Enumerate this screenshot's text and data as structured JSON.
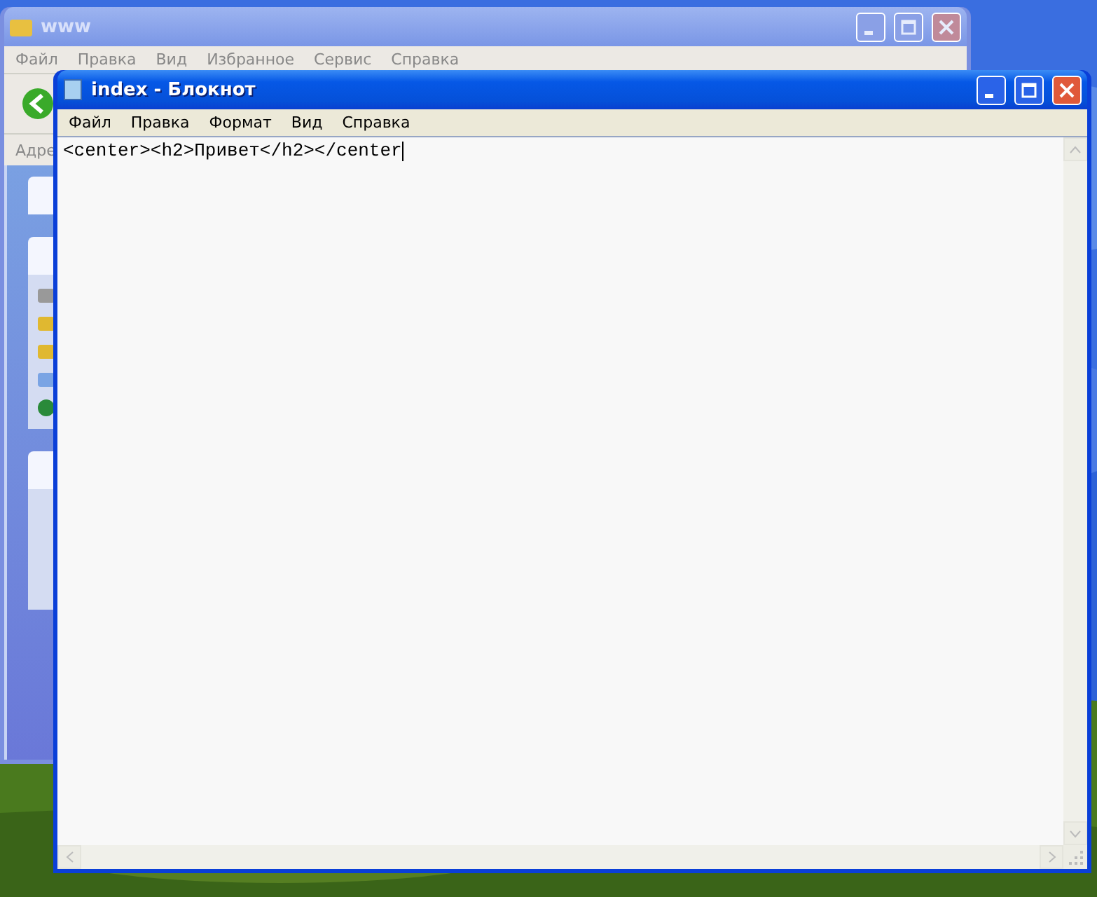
{
  "back_window": {
    "title": "www",
    "active": false,
    "menu": [
      "Файл",
      "Правка",
      "Вид",
      "Избранное",
      "Сервис",
      "Справка"
    ],
    "address_label": "Адре"
  },
  "notepad": {
    "title": "index - Блокнот",
    "active": true,
    "menu": [
      "Файл",
      "Правка",
      "Формат",
      "Вид",
      "Справка"
    ],
    "content": "<center><h2>Привет</h2></center"
  }
}
